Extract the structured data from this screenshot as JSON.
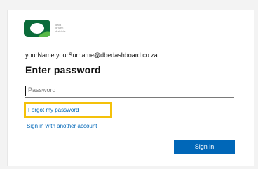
{
  "brand": {
    "lines": [
      "data",
      "driven",
      "districts"
    ]
  },
  "login": {
    "identity": "yourName.yourSurname@dbedashboard.co.za",
    "title": "Enter password",
    "password_placeholder": "Password",
    "forgot_password": "Forgot my password",
    "alternate_account": "Sign in with another account",
    "sign_in": "Sign in"
  },
  "colors": {
    "accent": "#0067b8",
    "highlight": "#f4c10a",
    "logo_dark": "#0b6b3a",
    "logo_light": "#58b947"
  }
}
